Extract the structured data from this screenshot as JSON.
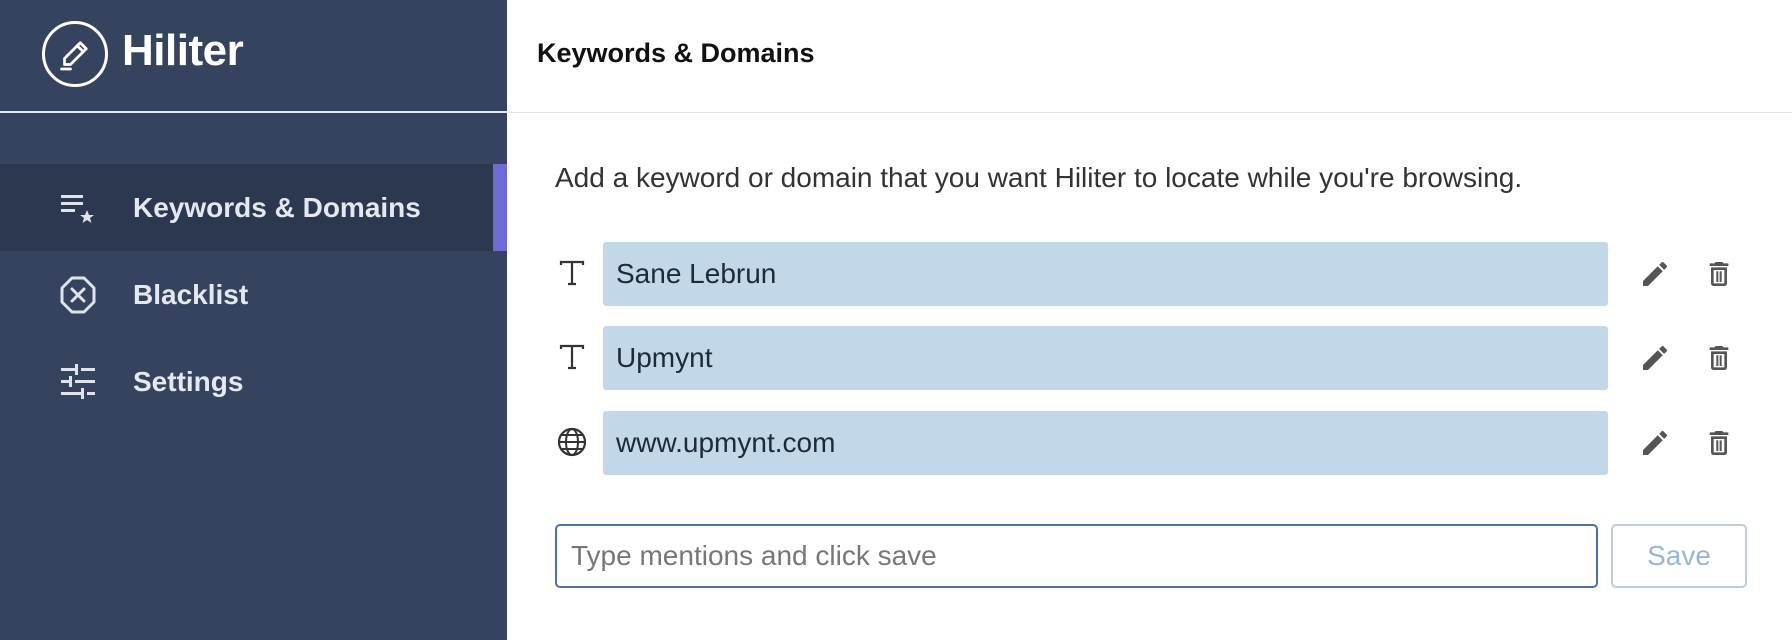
{
  "brand": {
    "name": "Hiliter",
    "logo_icon": "pen-circle-icon"
  },
  "nav": {
    "items": [
      {
        "label": "Keywords & Domains",
        "icon": "list-star-icon",
        "active": true
      },
      {
        "label": "Blacklist",
        "icon": "x-octagon-icon",
        "active": false
      },
      {
        "label": "Settings",
        "icon": "sliders-icon",
        "active": false
      }
    ]
  },
  "page": {
    "title": "Keywords & Domains",
    "description": "Add a keyword or domain that you want Hiliter to locate while you're browsing."
  },
  "keywords": [
    {
      "type": "text",
      "type_icon": "text-type-icon",
      "value": "Sane Lebrun"
    },
    {
      "type": "text",
      "type_icon": "text-type-icon",
      "value": "Upmynt"
    },
    {
      "type": "domain",
      "type_icon": "globe-icon",
      "value": "www.upmynt.com"
    }
  ],
  "new_entry": {
    "placeholder": "Type mentions and click save",
    "value": "",
    "save_label": "Save"
  },
  "colors": {
    "sidebar": "#36435f",
    "sidebar_active": "#2c3850",
    "accent": "#6e6bd6",
    "keyword_field": "#c2d7e7",
    "input_border": "#4b70b0",
    "save_disabled": "#99b6d6"
  }
}
